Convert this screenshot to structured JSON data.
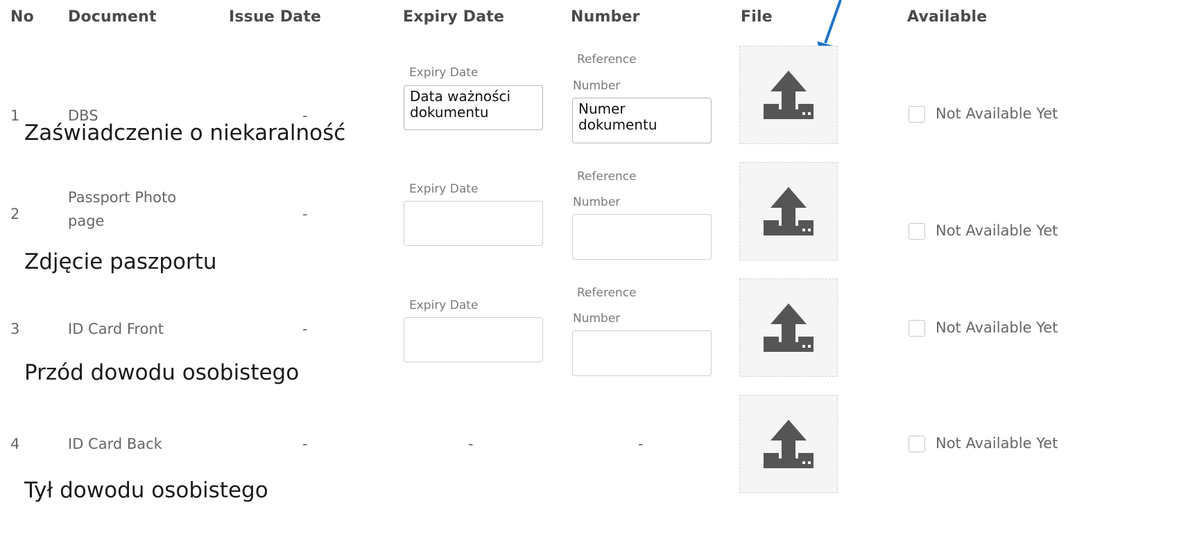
{
  "headers": {
    "no": "No",
    "document": "Document",
    "issue_date": "Issue Date",
    "expiry_date": "Expiry Date",
    "number": "Number",
    "file": "File",
    "available": "Available"
  },
  "rows": [
    {
      "no": "1",
      "document_lines": [
        "DBS"
      ],
      "issue_date": "-",
      "expiry_label": "Expiry Date",
      "expiry_value": "Data ważności\ndokumentu",
      "reference_label_1": "Reference",
      "reference_label_2": "Number",
      "reference_value": "Numer\ndokumentu",
      "available_label": "Not Available Yet",
      "translation": "Zaświadczenie o niekaralność"
    },
    {
      "no": "2",
      "document_lines": [
        "Passport Photo",
        "page"
      ],
      "issue_date": "-",
      "expiry_label": "Expiry Date",
      "expiry_value": "",
      "reference_label_1": "Reference",
      "reference_label_2": "Number",
      "reference_value": "",
      "available_label": "Not Available Yet",
      "translation": "Zdjęcie paszportu"
    },
    {
      "no": "3",
      "document_lines": [
        "ID Card Front"
      ],
      "issue_date": "-",
      "expiry_label": "Expiry Date",
      "expiry_value": "",
      "reference_label_1": "Reference",
      "reference_label_2": "Number",
      "reference_value": "",
      "available_label": "Not Available Yet",
      "translation": "Przód dowodu osobistego"
    },
    {
      "no": "4",
      "document_lines": [
        "ID Card Back"
      ],
      "issue_date": "-",
      "expiry_dash": "-",
      "number_dash": "-",
      "available_label": "Not Available Yet",
      "translation": "Tył dowodu osobistego"
    }
  ],
  "icons": {
    "upload": "upload-icon",
    "annotation_arrow": "arrow-icon"
  },
  "colors": {
    "arrow": "#1f73c9",
    "upload_icon": "#555555"
  }
}
